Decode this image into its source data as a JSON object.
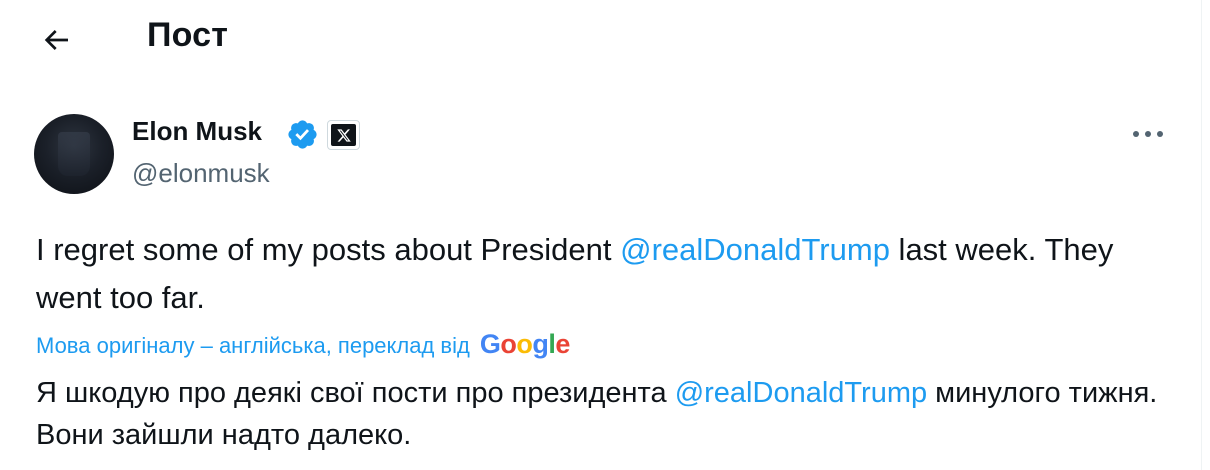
{
  "header": {
    "title": "Пост",
    "back_icon": "arrow-left-icon"
  },
  "post": {
    "author": {
      "name": "Elon Musk",
      "handle": "@elonmusk",
      "verified": true,
      "affiliate_badge": "x-logo-icon"
    },
    "text": {
      "part1": "I regret some of my posts about President ",
      "mention": "@realDonaldTrump",
      "part2": " last week. They went too far."
    },
    "translation": {
      "label": "Мова оригіналу – англійська, переклад від",
      "provider": "Google",
      "part1": "Я шкодую про деякі свої пости про президента ",
      "mention": "@realDonaldTrump",
      "part2": " минулого тижня. Вони зайшли надто далеко."
    }
  },
  "colors": {
    "accent": "#1d9bf0",
    "text": "#0f1419",
    "secondary": "#536471",
    "google_blue": "#4285F4",
    "google_red": "#EA4335",
    "google_yellow": "#FBBC05",
    "google_green": "#34A853"
  }
}
